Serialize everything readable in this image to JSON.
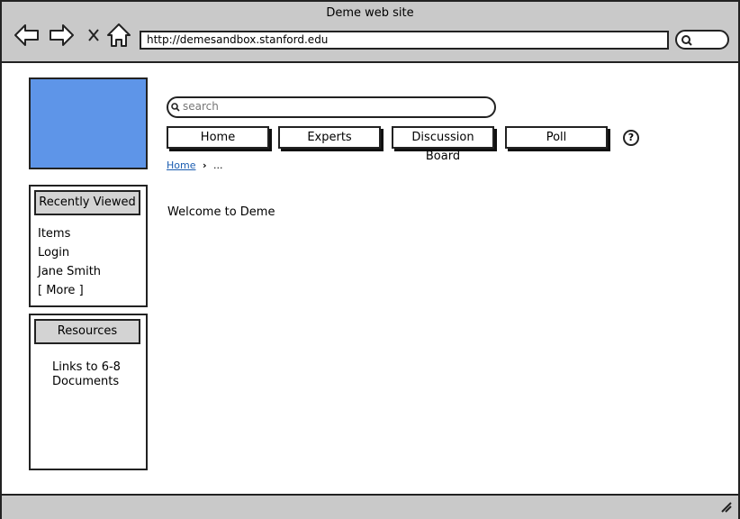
{
  "window": {
    "title": "Deme web site"
  },
  "browser": {
    "url": "http://demesandbox.stanford.edu"
  },
  "search": {
    "placeholder": "search"
  },
  "tabs": [
    "Home",
    "Experts",
    "Discussion Board",
    "Poll"
  ],
  "help": {
    "label": "?"
  },
  "breadcrumb": {
    "home": "Home",
    "current": "..."
  },
  "recently_viewed": {
    "title": "Recently Viewed",
    "items": [
      "Items",
      "Login",
      "Jane Smith",
      "[ More ]"
    ]
  },
  "resources": {
    "title": "Resources",
    "text_line1": "Links to 6-8",
    "text_line2": "Documents"
  },
  "main": {
    "welcome": "Welcome to Deme"
  },
  "colors": {
    "logo": "#5e95e8",
    "chrome": "#c9c9c9",
    "link": "#1a5cb0"
  }
}
